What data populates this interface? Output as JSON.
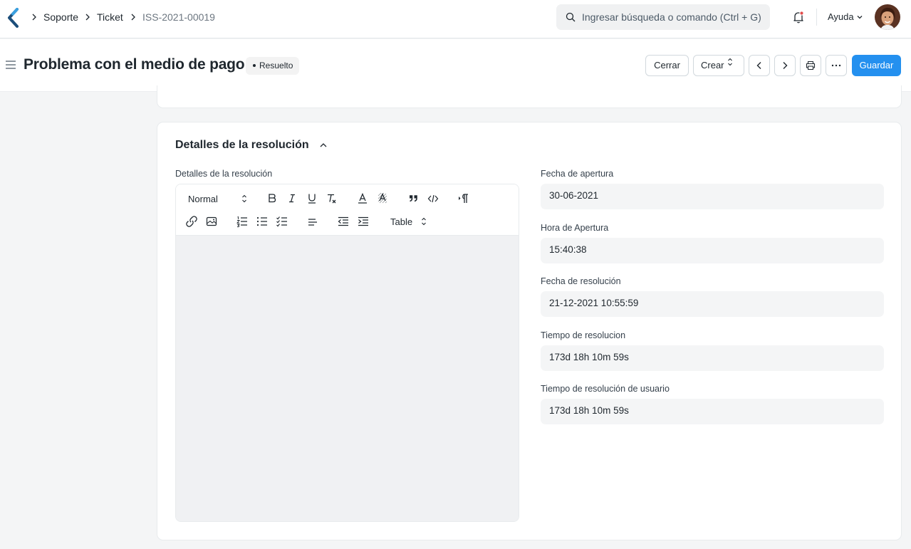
{
  "navbar": {
    "breadcrumbs": [
      "Soporte",
      "Ticket",
      "ISS-2021-00019"
    ],
    "search_placeholder": "Ingresar búsqueda o comando (Ctrl + G)",
    "help_label": "Ayuda"
  },
  "page": {
    "title": "Problema con el medio de pago",
    "status": "Resuelto",
    "actions": {
      "close_label": "Cerrar",
      "create_label": "Crear",
      "save_label": "Guardar"
    }
  },
  "section": {
    "title": "Detalles de la resolución",
    "editor_label": "Detalles de la resolución",
    "editor_toolbar": {
      "format": "Normal",
      "table": "Table",
      "buttons_row1": [
        "bold-icon",
        "italic-icon",
        "underline-icon",
        "clear-format-icon",
        "text-color-icon",
        "background-color-icon",
        "blockquote-icon",
        "code-block-icon",
        "text-direction-icon"
      ],
      "buttons_row2": [
        "link-icon",
        "image-icon",
        "ordered-list-icon",
        "bullet-list-icon",
        "check-list-icon",
        "align-icon",
        "outdent-icon",
        "indent-icon"
      ]
    },
    "fields": [
      {
        "label": "Fecha de apertura",
        "value": "30-06-2021"
      },
      {
        "label": "Hora de Apertura",
        "value": "15:40:38"
      },
      {
        "label": "Fecha de resolución",
        "value": "21-12-2021 10:55:59"
      },
      {
        "label": "Tiempo de resolucion",
        "value": "173d 18h 10m 59s"
      },
      {
        "label": "Tiempo de resolución de usuario",
        "value": "173d 18h 10m 59s"
      }
    ]
  },
  "colors": {
    "primary": "#2490ef",
    "logo": "#1c4e7a",
    "notification_dot": "#e24c4c"
  }
}
